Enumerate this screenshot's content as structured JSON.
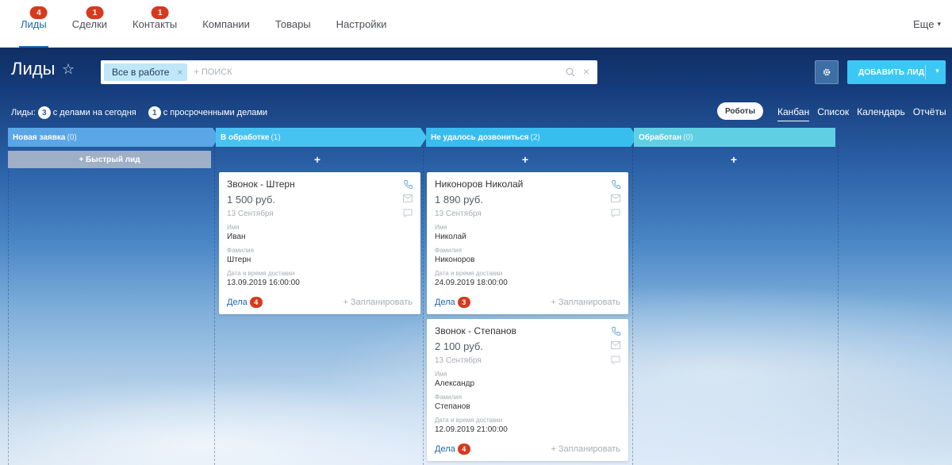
{
  "nav": {
    "tabs": [
      {
        "label": "Лиды",
        "counter": "4"
      },
      {
        "label": "Сделки",
        "counter": "1"
      },
      {
        "label": "Контакты",
        "counter": "1"
      },
      {
        "label": "Компании"
      },
      {
        "label": "Товары"
      },
      {
        "label": "Настройки"
      }
    ],
    "more_label": "Еще"
  },
  "header": {
    "title": "Лиды",
    "filter_chip": "Все в работе",
    "search_placeholder": "+ поиск",
    "add_button": "ДОБАВИТЬ ЛИД"
  },
  "stats": {
    "prefix": "Лиды:",
    "today_count": "3",
    "today_label": "с делами на сегодня",
    "overdue_count": "1",
    "overdue_label": "с просроченными делами"
  },
  "toolbar": {
    "robots": "Роботы",
    "views": [
      "Канбан",
      "Список",
      "Календарь",
      "Отчёты"
    ],
    "active_view": "Канбан"
  },
  "colors": {
    "col_new": "#5aa6e6",
    "col_processing": "#47c3f2",
    "col_failed": "#38bdef",
    "col_done": "#5fd0e4",
    "accent": "#2067b0",
    "badge": "#d63a1e"
  },
  "columns": [
    {
      "name": "Новая заявка",
      "count": "(0)"
    },
    {
      "name": "В обработке",
      "count": "(1)"
    },
    {
      "name": "Не удалось дозвониться",
      "count": "(2)"
    },
    {
      "name": "Обработан",
      "count": "(0)"
    }
  ],
  "quick_lead": "+ Быстрый лид",
  "add_plus": "+",
  "labels": {
    "first_name": "Имя",
    "last_name": "Фамилия",
    "delivery": "Дата и время доставки",
    "deals": "Дела",
    "plan": "+ Запланировать"
  },
  "cards": [
    {
      "title": "Звонок - Штерн",
      "price": "1 500 руб.",
      "date": "13 Сентября",
      "first_name": "Иван",
      "last_name": "Штерн",
      "delivery": "13.09.2019 16:00:00",
      "deals_count": "4"
    },
    {
      "title": "Никоноров Николай",
      "price": "1 890 руб.",
      "date": "13 Сентября",
      "first_name": "Николай",
      "last_name": "Никоноров",
      "delivery": "24.09.2019 18:00:00",
      "deals_count": "3"
    },
    {
      "title": "Звонок - Степанов",
      "price": "2 100 руб.",
      "date": "13 Сентября",
      "first_name": "Александр",
      "last_name": "Степанов",
      "delivery": "12.09.2019 21:00:00",
      "deals_count": "4"
    }
  ]
}
